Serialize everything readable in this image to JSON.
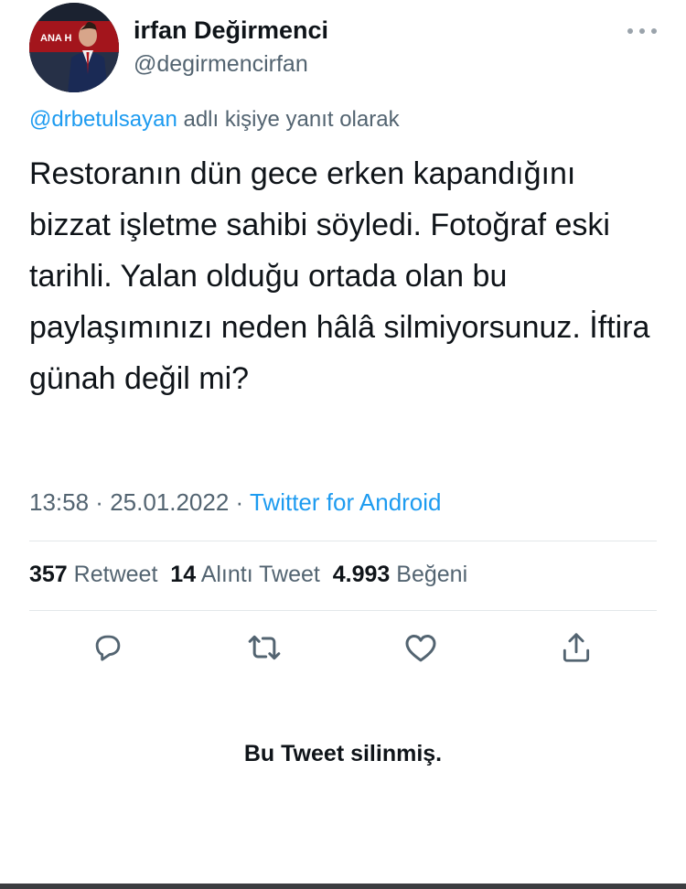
{
  "user": {
    "display_name": "irfan Değirmenci",
    "handle": "@degirmencirfan",
    "avatar_caption": "ANA H"
  },
  "reply": {
    "mention": "@drbetulsayan",
    "text": " adlı kişiye yanıt olarak"
  },
  "tweet": {
    "text": "Restoranın dün gece erken kapandığını bizzat işletme sahibi söyledi. Fotoğraf eski tarihli. Yalan olduğu ortada olan bu paylaşımınızı neden hâlâ silmiyorsunuz. İftira günah değil mi?",
    "time": "13:58",
    "sep1": " · ",
    "date": "25.01.2022",
    "sep2": " · ",
    "source": "Twitter for Android"
  },
  "stats": {
    "retweets": "357",
    "retweets_label": "Retweet",
    "quotes": "14",
    "quotes_label": "Alıntı Tweet",
    "likes": "4.993",
    "likes_label": "Beğeni"
  },
  "actions": [
    {
      "icon": "reply-icon"
    },
    {
      "icon": "retweet-icon"
    },
    {
      "icon": "like-icon"
    },
    {
      "icon": "share-icon"
    }
  ],
  "deleted_notice": "Bu Tweet silinmiş.",
  "colors": {
    "accent": "#1d9bf0",
    "text": "#0f1419",
    "secondary": "#536471",
    "divider": "#e3e7ea"
  }
}
